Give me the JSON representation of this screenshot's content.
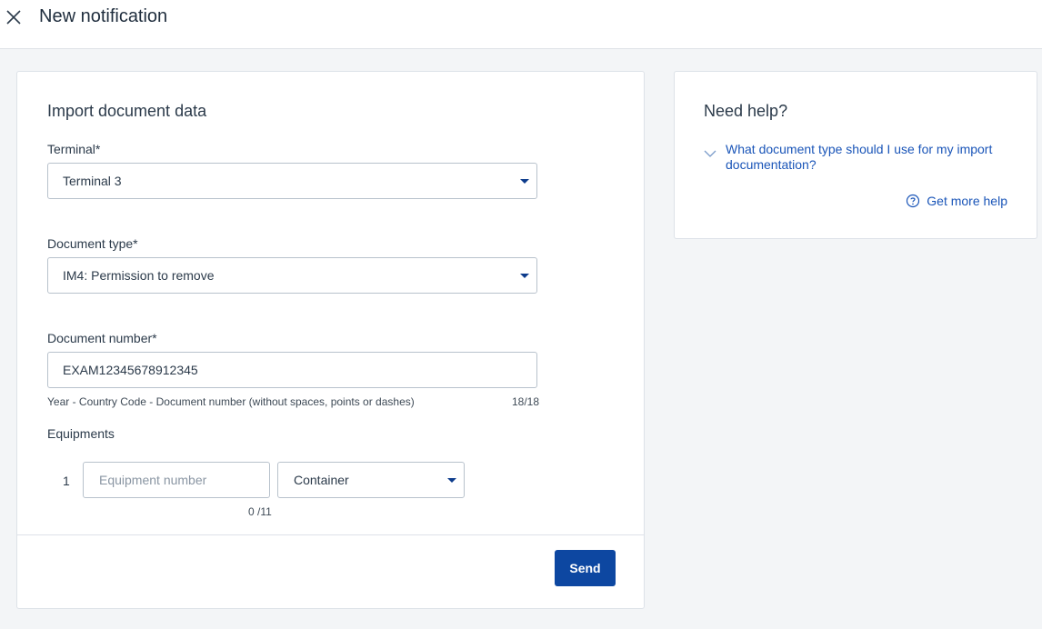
{
  "header": {
    "title": "New notification",
    "close_icon": "close-icon"
  },
  "form": {
    "section_title": "Import document data",
    "terminal": {
      "label": "Terminal*",
      "value": "Terminal 3"
    },
    "document_type": {
      "label": "Document type*",
      "value": "IM4: Permission to remove"
    },
    "document_number": {
      "label": "Document number*",
      "value": "EXAM12345678912345",
      "hint": "Year - Country Code - Document number (without spaces, points or dashes)",
      "counter": "18/18"
    },
    "equipments": {
      "label": "Equipments",
      "rows": [
        {
          "index": "1",
          "placeholder": "Equipment number",
          "counter": "0 /11",
          "type": "Container"
        }
      ]
    },
    "send_label": "Send"
  },
  "help": {
    "title": "Need help?",
    "faq_question": "What document type should I use for my import documentation?",
    "more_help_label": "Get more help"
  },
  "colors": {
    "accent": "#0d47a1",
    "link": "#1a55b8",
    "background": "#f3f5f7"
  }
}
